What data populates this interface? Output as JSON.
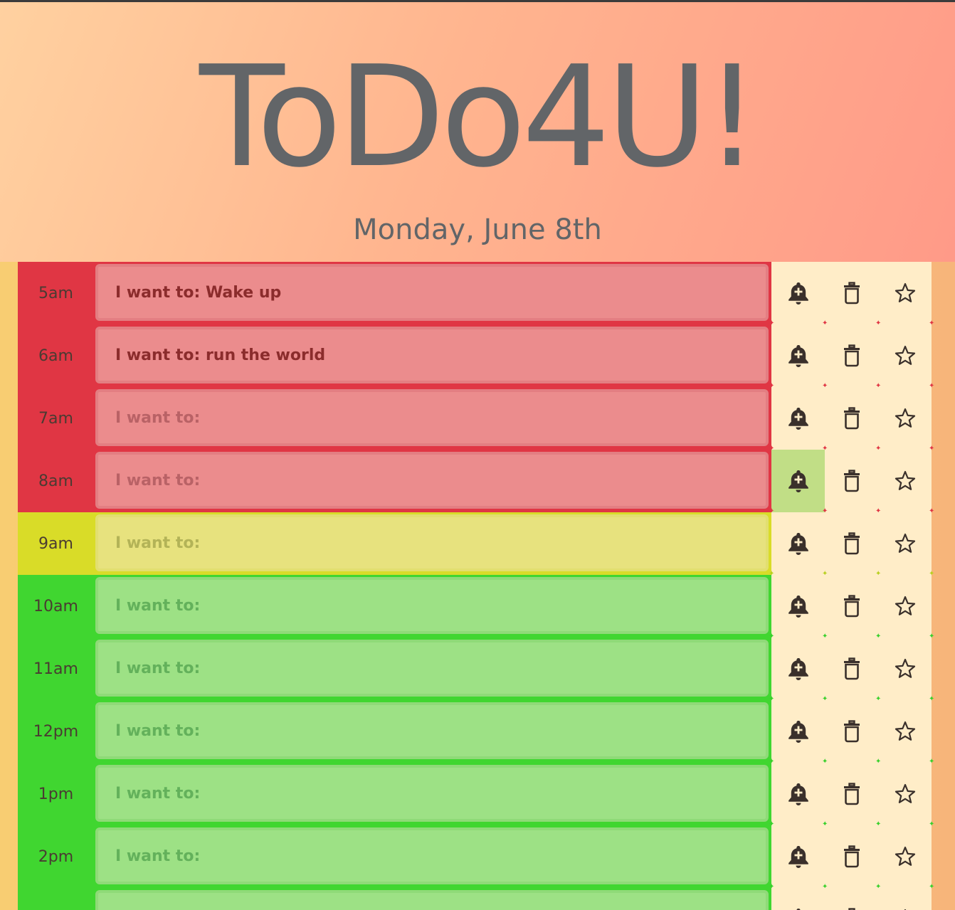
{
  "app": {
    "title": "ToDo4U!",
    "date": "Monday, June 8th"
  },
  "colors": {
    "past": "#e03644",
    "present": "#d9dc28",
    "future": "#40d630",
    "text": "#626568"
  },
  "icons": {
    "alarm": "bell-plus-icon",
    "delete": "trash-icon",
    "favorite": "star-icon"
  },
  "schedule": [
    {
      "hour": "5am",
      "status": "past",
      "value": "I want to: Wake up",
      "placeholder": "I want to:"
    },
    {
      "hour": "6am",
      "status": "past",
      "value": "I want to: run the world",
      "placeholder": "I want to:"
    },
    {
      "hour": "7am",
      "status": "past",
      "value": "",
      "placeholder": "I want to:"
    },
    {
      "hour": "8am",
      "status": "past",
      "value": "",
      "placeholder": "I want to:",
      "alarm_active": true
    },
    {
      "hour": "9am",
      "status": "present",
      "value": "",
      "placeholder": "I want to:"
    },
    {
      "hour": "10am",
      "status": "future",
      "value": "",
      "placeholder": "I want to:"
    },
    {
      "hour": "11am",
      "status": "future",
      "value": "",
      "placeholder": "I want to:"
    },
    {
      "hour": "12pm",
      "status": "future",
      "value": "",
      "placeholder": "I want to:"
    },
    {
      "hour": "1pm",
      "status": "future",
      "value": "",
      "placeholder": "I want to:"
    },
    {
      "hour": "2pm",
      "status": "future",
      "value": "",
      "placeholder": "I want to:"
    },
    {
      "hour": "",
      "status": "future",
      "value": "",
      "placeholder": ""
    }
  ]
}
